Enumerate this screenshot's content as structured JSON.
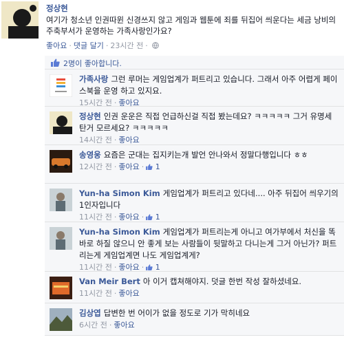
{
  "post": {
    "author": "정상현",
    "text": "여기가 청소년 인권따윈 신경쓰지 않고 게임과 웹툰에 죄를 뒤집어 씌운다는 세금 낭비의 주축부서가 운영하는 가족사랑인가요?",
    "actions": {
      "like": "좋아요",
      "hide_comments": "댓글 달기",
      "time": "23시간 전"
    }
  },
  "likes": {
    "text": "2명이 좋아합니다."
  },
  "comments": [
    {
      "author": "가족사랑",
      "text": "그런 루머는 게임업계가 퍼트리고 있습니다. 그래서 아주 어렵게 페이스북을 운영 하고 있지요.",
      "time": "15시간 전",
      "like": "좋아요",
      "like_count": ""
    },
    {
      "author": "정상현",
      "text": "인권 운운은 직접 언급하신걸 직접 봤는데요? ㅋㅋㅋㅋㅋ 그거 유명세 탄거 모르세요? ㅋㅋㅋㅋㅋ",
      "time": "14시간 전",
      "like": "좋아요",
      "like_count": ""
    },
    {
      "author": "송영웅",
      "text": "요즘은 군대는 집지키는개 발언 안나와서 정말다행입니다 ㅎㅎ",
      "time": "12시간 전",
      "like": "좋아요",
      "like_count": "1"
    },
    {
      "author": "Yun-ha Simon Kim",
      "text": "게임업계가 퍼트리고 있다네.... 아주 뒤집어 씌우기의 1인자입니다",
      "time": "11시간 전",
      "like": "좋아요",
      "like_count": "1"
    },
    {
      "author": "Yun-ha Simon Kim",
      "text": "게임업계가 퍼트리는게 아니고 여가부에서 처신을 똑바로 하질 않으니 안 좋게 보는 사람들이 뒷말하고 다니는게 그거 아닌가? 퍼트리는게 게임업계면 나도 게임업계게?",
      "time": "11시간 전",
      "like": "좋아요",
      "like_count": "1"
    },
    {
      "author": "Van Meir Bert",
      "text": "아 이거 캡쳐해야지. 덧글 한번 작성 잘하셨네요.",
      "time": "11시간 전",
      "like": "좋아요",
      "like_count": ""
    },
    {
      "author": "김상엽",
      "text": "답변한 번 어이가 없을 정도로 기가 막히네요",
      "time": "6시간 전",
      "like": "좋아요",
      "like_count": ""
    }
  ],
  "colors": {
    "link": "#3b5998",
    "muted": "#9197a3",
    "comment_bg": "#f6f7f9",
    "border": "#e1e2e3"
  }
}
